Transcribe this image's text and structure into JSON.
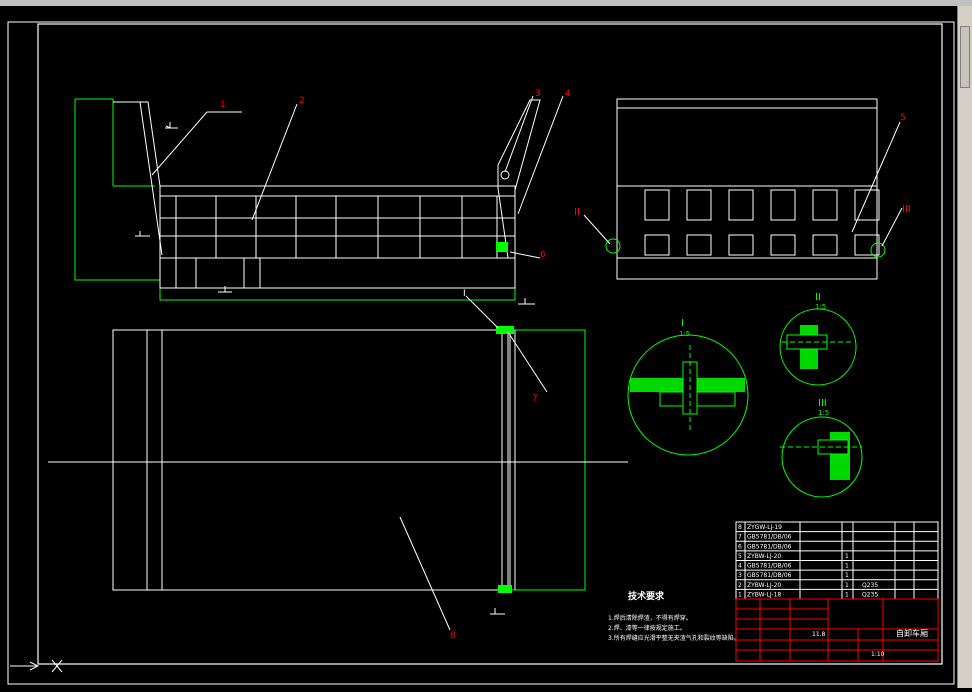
{
  "window": {
    "title": ""
  },
  "callouts": [
    "1",
    "2",
    "3",
    "4",
    "5",
    "6",
    "7",
    "8"
  ],
  "detail_views": {
    "I": {
      "label": "I",
      "scale": "1:5"
    },
    "II": {
      "label": "II",
      "scale": "1:5"
    },
    "III": {
      "label": "III",
      "scale": "1:5"
    }
  },
  "side_view_markers": {
    "left": "II",
    "right": "III"
  },
  "section_marker": "I",
  "tech_requirements": {
    "title": "技术要求",
    "items": [
      "1.焊后清除焊渣，不得有焊穿。",
      "2.焊、漆等一律按规定施工。",
      "3.所有焊缝应光滑平整无夹渣气孔和裂纹等缺陷。"
    ]
  },
  "bom_rows": [
    {
      "no": "8",
      "code": "ZYGW-LJ-19",
      "name": "",
      "qty": "",
      "material": ""
    },
    {
      "no": "7",
      "code": "GB5781/DB/06",
      "name": "",
      "qty": "",
      "material": ""
    },
    {
      "no": "6",
      "code": "GB5781/DB/06",
      "name": "",
      "qty": "",
      "material": ""
    },
    {
      "no": "5",
      "code": "ZYBW-LJ-20",
      "name": "",
      "qty": "1",
      "material": ""
    },
    {
      "no": "4",
      "code": "GB5781/DB/06",
      "name": "",
      "qty": "1",
      "material": ""
    },
    {
      "no": "3",
      "code": "GB5781/DB/06",
      "name": "",
      "qty": "1",
      "material": ""
    },
    {
      "no": "2",
      "code": "ZYBW-LJ-20",
      "name": "",
      "qty": "1",
      "material": "Q235"
    },
    {
      "no": "1",
      "code": "ZYBW-LJ-18",
      "name": "",
      "qty": "1",
      "material": "Q235"
    }
  ],
  "title_block": {
    "drawing_name": "自卸车厢",
    "scale": "1:10",
    "weight": "11.8",
    "sheet": "1"
  },
  "colors": {
    "outline": "#ffffff",
    "part": "#00ff00",
    "callout": "#ff0000",
    "dimension": "#00ff00",
    "table": "#ff0000",
    "text": "#ffffff"
  }
}
